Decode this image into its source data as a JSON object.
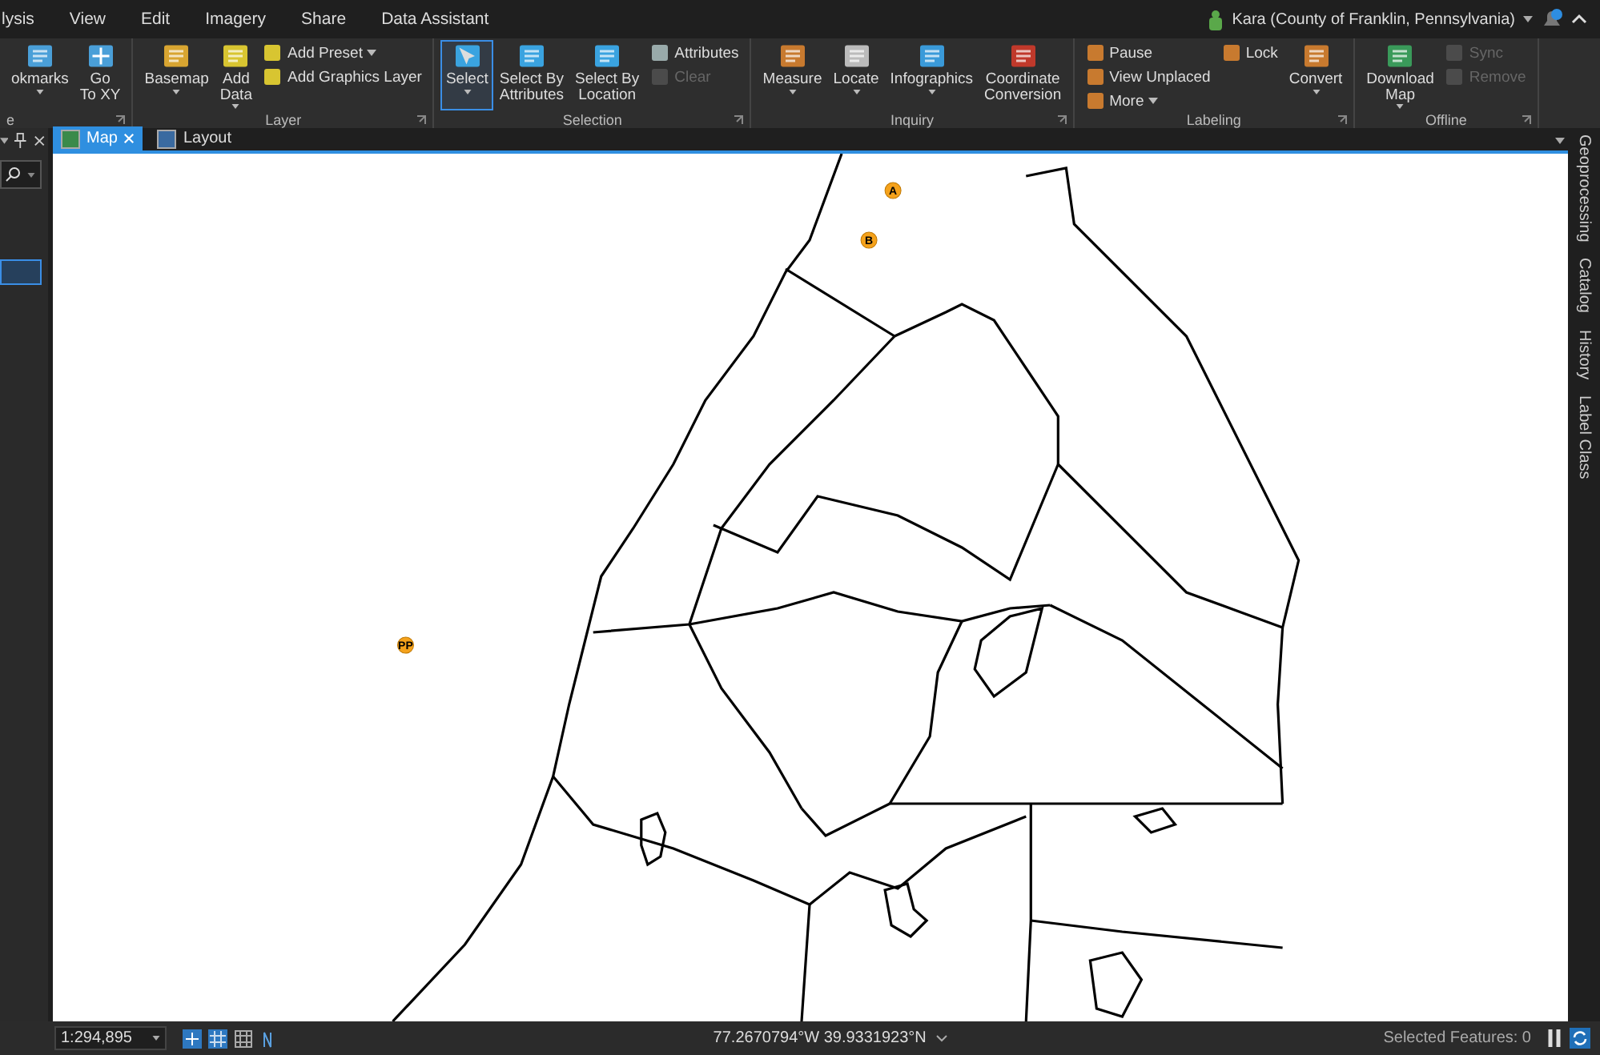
{
  "menu_tabs": [
    {
      "label": "lysis"
    },
    {
      "label": "View"
    },
    {
      "label": "Edit"
    },
    {
      "label": "Imagery"
    },
    {
      "label": "Share"
    },
    {
      "label": "Data Assistant"
    }
  ],
  "user": {
    "name": "Kara (County of Franklin, Pennsylvania)"
  },
  "ribbon": {
    "groups": [
      {
        "label": "e",
        "items": [
          {
            "kind": "large",
            "label": "okmarks",
            "dropdown": true,
            "selected": false,
            "disabled": false
          },
          {
            "kind": "large",
            "label": "Go\nTo XY",
            "dropdown": false,
            "selected": false,
            "disabled": false
          }
        ]
      },
      {
        "label": "Layer",
        "items": [
          {
            "kind": "large",
            "label": "Basemap",
            "dropdown": true,
            "selected": false,
            "disabled": false
          },
          {
            "kind": "large",
            "label": "Add\nData",
            "dropdown": true,
            "selected": false,
            "disabled": false
          },
          {
            "kind": "small",
            "label": "Add Preset",
            "dropdown": true,
            "selected": false,
            "disabled": false
          },
          {
            "kind": "small",
            "label": "Add Graphics Layer",
            "dropdown": false,
            "selected": false,
            "disabled": false
          }
        ]
      },
      {
        "label": "Selection",
        "items": [
          {
            "kind": "large",
            "label": "Select",
            "dropdown": true,
            "selected": true,
            "disabled": false
          },
          {
            "kind": "large",
            "label": "Select By\nAttributes",
            "dropdown": false,
            "selected": false,
            "disabled": false
          },
          {
            "kind": "large",
            "label": "Select By\nLocation",
            "dropdown": false,
            "selected": false,
            "disabled": false
          },
          {
            "kind": "small",
            "label": "Attributes",
            "dropdown": false,
            "selected": false,
            "disabled": false
          },
          {
            "kind": "small",
            "label": "Clear",
            "dropdown": false,
            "selected": false,
            "disabled": true
          }
        ]
      },
      {
        "label": "Inquiry",
        "items": [
          {
            "kind": "large",
            "label": "Measure",
            "dropdown": true,
            "selected": false,
            "disabled": false
          },
          {
            "kind": "large",
            "label": "Locate",
            "dropdown": true,
            "selected": false,
            "disabled": false
          },
          {
            "kind": "large",
            "label": "Infographics",
            "dropdown": true,
            "selected": false,
            "disabled": false
          },
          {
            "kind": "large",
            "label": "Coordinate\nConversion",
            "dropdown": false,
            "selected": false,
            "disabled": false
          }
        ]
      },
      {
        "label": "Labeling",
        "items": [
          {
            "kind": "small",
            "label": "Pause",
            "dropdown": false,
            "selected": false,
            "disabled": false
          },
          {
            "kind": "small",
            "label": "View Unplaced",
            "dropdown": false,
            "selected": false,
            "disabled": false
          },
          {
            "kind": "small",
            "label": "More",
            "dropdown": true,
            "selected": false,
            "disabled": false
          },
          {
            "kind": "small",
            "label": "Lock",
            "dropdown": false,
            "selected": false,
            "disabled": false
          },
          {
            "kind": "large",
            "label": "Convert",
            "dropdown": true,
            "selected": false,
            "disabled": false
          }
        ]
      },
      {
        "label": "Offline",
        "items": [
          {
            "kind": "large",
            "label": "Download\nMap",
            "dropdown": true,
            "selected": false,
            "disabled": false
          },
          {
            "kind": "small",
            "label": "Sync",
            "dropdown": false,
            "selected": false,
            "disabled": true
          },
          {
            "kind": "small",
            "label": "Remove",
            "dropdown": false,
            "selected": false,
            "disabled": true
          }
        ]
      }
    ]
  },
  "contents_pane": {
    "rows": [
      {
        "selected": true
      }
    ]
  },
  "view_tabs": [
    {
      "label": "Map",
      "selected": true
    },
    {
      "label": "Layout",
      "selected": false
    }
  ],
  "map": {
    "markers": [
      {
        "label": "A"
      },
      {
        "label": "B"
      },
      {
        "label": "PP"
      }
    ]
  },
  "dock_tabs": [
    {
      "label": "Geoprocessing"
    },
    {
      "label": "Catalog"
    },
    {
      "label": "History"
    },
    {
      "label": "Label Class"
    }
  ],
  "status_bar": {
    "scale": "1:294,895",
    "coordinates": "77.2670794°W 39.9331923°N",
    "selected_features": "Selected Features: 0"
  }
}
